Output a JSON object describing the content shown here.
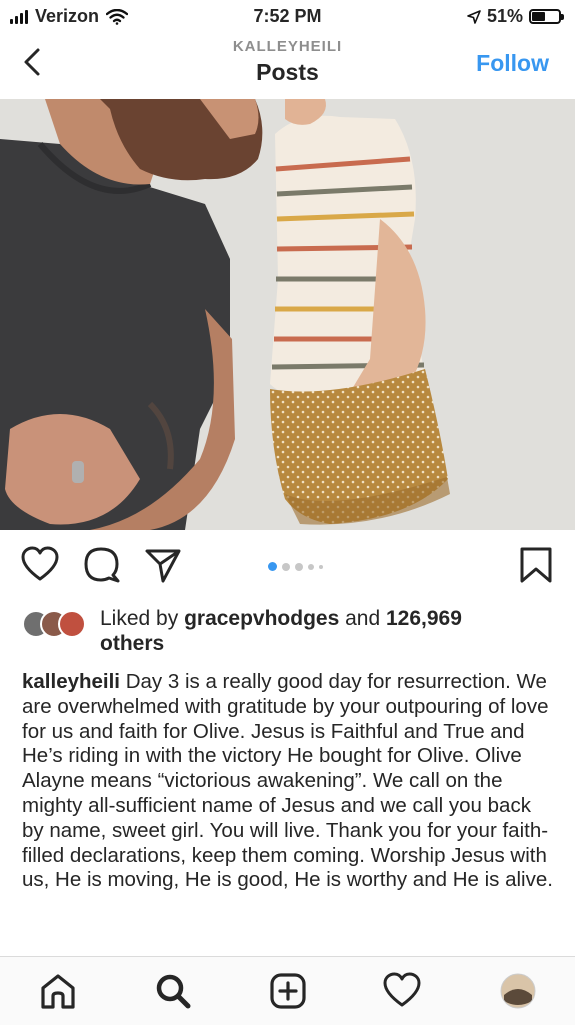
{
  "status_bar": {
    "carrier": "Verizon",
    "time": "7:52 PM",
    "battery": "51%",
    "battery_level": 0.51
  },
  "header": {
    "username": "KALLEYHEILI",
    "title": "Posts",
    "follow_label": "Follow"
  },
  "post": {
    "carousel_total": 5,
    "carousel_active": 1,
    "likes": {
      "prefix": "Liked by ",
      "user": "gracepvhodges",
      "middle": " and ",
      "count": "126,969",
      "suffix": "others"
    },
    "caption": {
      "username": "kalleyheili",
      "text": " Day 3 is a really good day for resurrection. We are overwhelmed with gratitude by your outpouring of love for us and faith for Olive. Jesus is Faithful and True and He’s riding in with the victory He bought for Olive. Olive Alayne means “victorious awakening”. We call on the mighty all-sufficient name of Jesus and we call you back by name, sweet girl. You will live. Thank you for your faith-filled declarations, keep them coming. Worship Jesus with us, He is moving, He is good, He is worthy and He is alive."
    }
  },
  "icons": {
    "back": "chevron-left-icon",
    "like": "heart-icon",
    "comment": "comment-bubble-icon",
    "share": "paper-plane-icon",
    "save": "bookmark-icon",
    "home": "home-icon",
    "search": "search-icon",
    "new_post": "plus-square-icon",
    "activity": "heart-icon",
    "profile": "profile-avatar"
  },
  "colors": {
    "accent": "#3897f0",
    "carousel_active": "#3897f0",
    "carousel_inactive": "#c7c7c7",
    "text": "#262626",
    "muted": "#8e8e8e"
  }
}
